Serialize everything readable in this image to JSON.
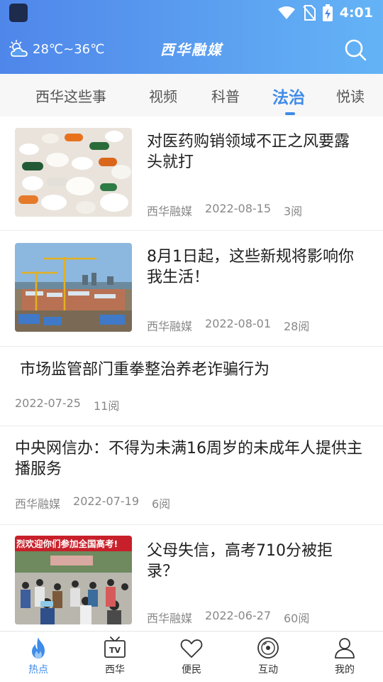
{
  "status_bar": {
    "time": "4:01"
  },
  "header": {
    "weather_text": "28℃~36℃",
    "app_title": "西华融媒"
  },
  "tabs": [
    {
      "label": "西华这些事"
    },
    {
      "label": "视频"
    },
    {
      "label": "科普"
    },
    {
      "label": "法治",
      "active": true
    },
    {
      "label": "悦读"
    }
  ],
  "feed": [
    {
      "title": "对医药购销领域不正之风要露头就打",
      "source": "西华融媒",
      "date": "2022-08-15",
      "reads": "3阅"
    },
    {
      "title": "8月1日起，这些新规将影响你我生活！",
      "source": "西华融媒",
      "date": "2022-08-01",
      "reads": "28阅"
    },
    {
      "title": " 市场监管部门重拳整治养老诈骗行为",
      "date": "2022-07-25",
      "reads": "11阅"
    },
    {
      "title": "中央网信办：不得为未满16周岁的未成年人提供主播服务",
      "source": "西华融媒",
      "date": "2022-07-19",
      "reads": "6阅"
    },
    {
      "title": "父母失信，高考710分被拒录？",
      "source": "西华融媒",
      "date": "2022-06-27",
      "reads": "60阅",
      "image_banner": "烈欢迎你们参加全国高考!"
    }
  ],
  "bottom_nav": [
    {
      "label": "热点",
      "icon": "flame-icon",
      "active": true
    },
    {
      "label": "西华",
      "icon": "tv-icon"
    },
    {
      "label": "便民",
      "icon": "heart-icon"
    },
    {
      "label": "互动",
      "icon": "disc-icon"
    },
    {
      "label": "我的",
      "icon": "user-icon"
    }
  ],
  "colors": {
    "accent": "#3e8be8",
    "header_start": "#4f86ea",
    "header_end": "#64b3f6"
  }
}
